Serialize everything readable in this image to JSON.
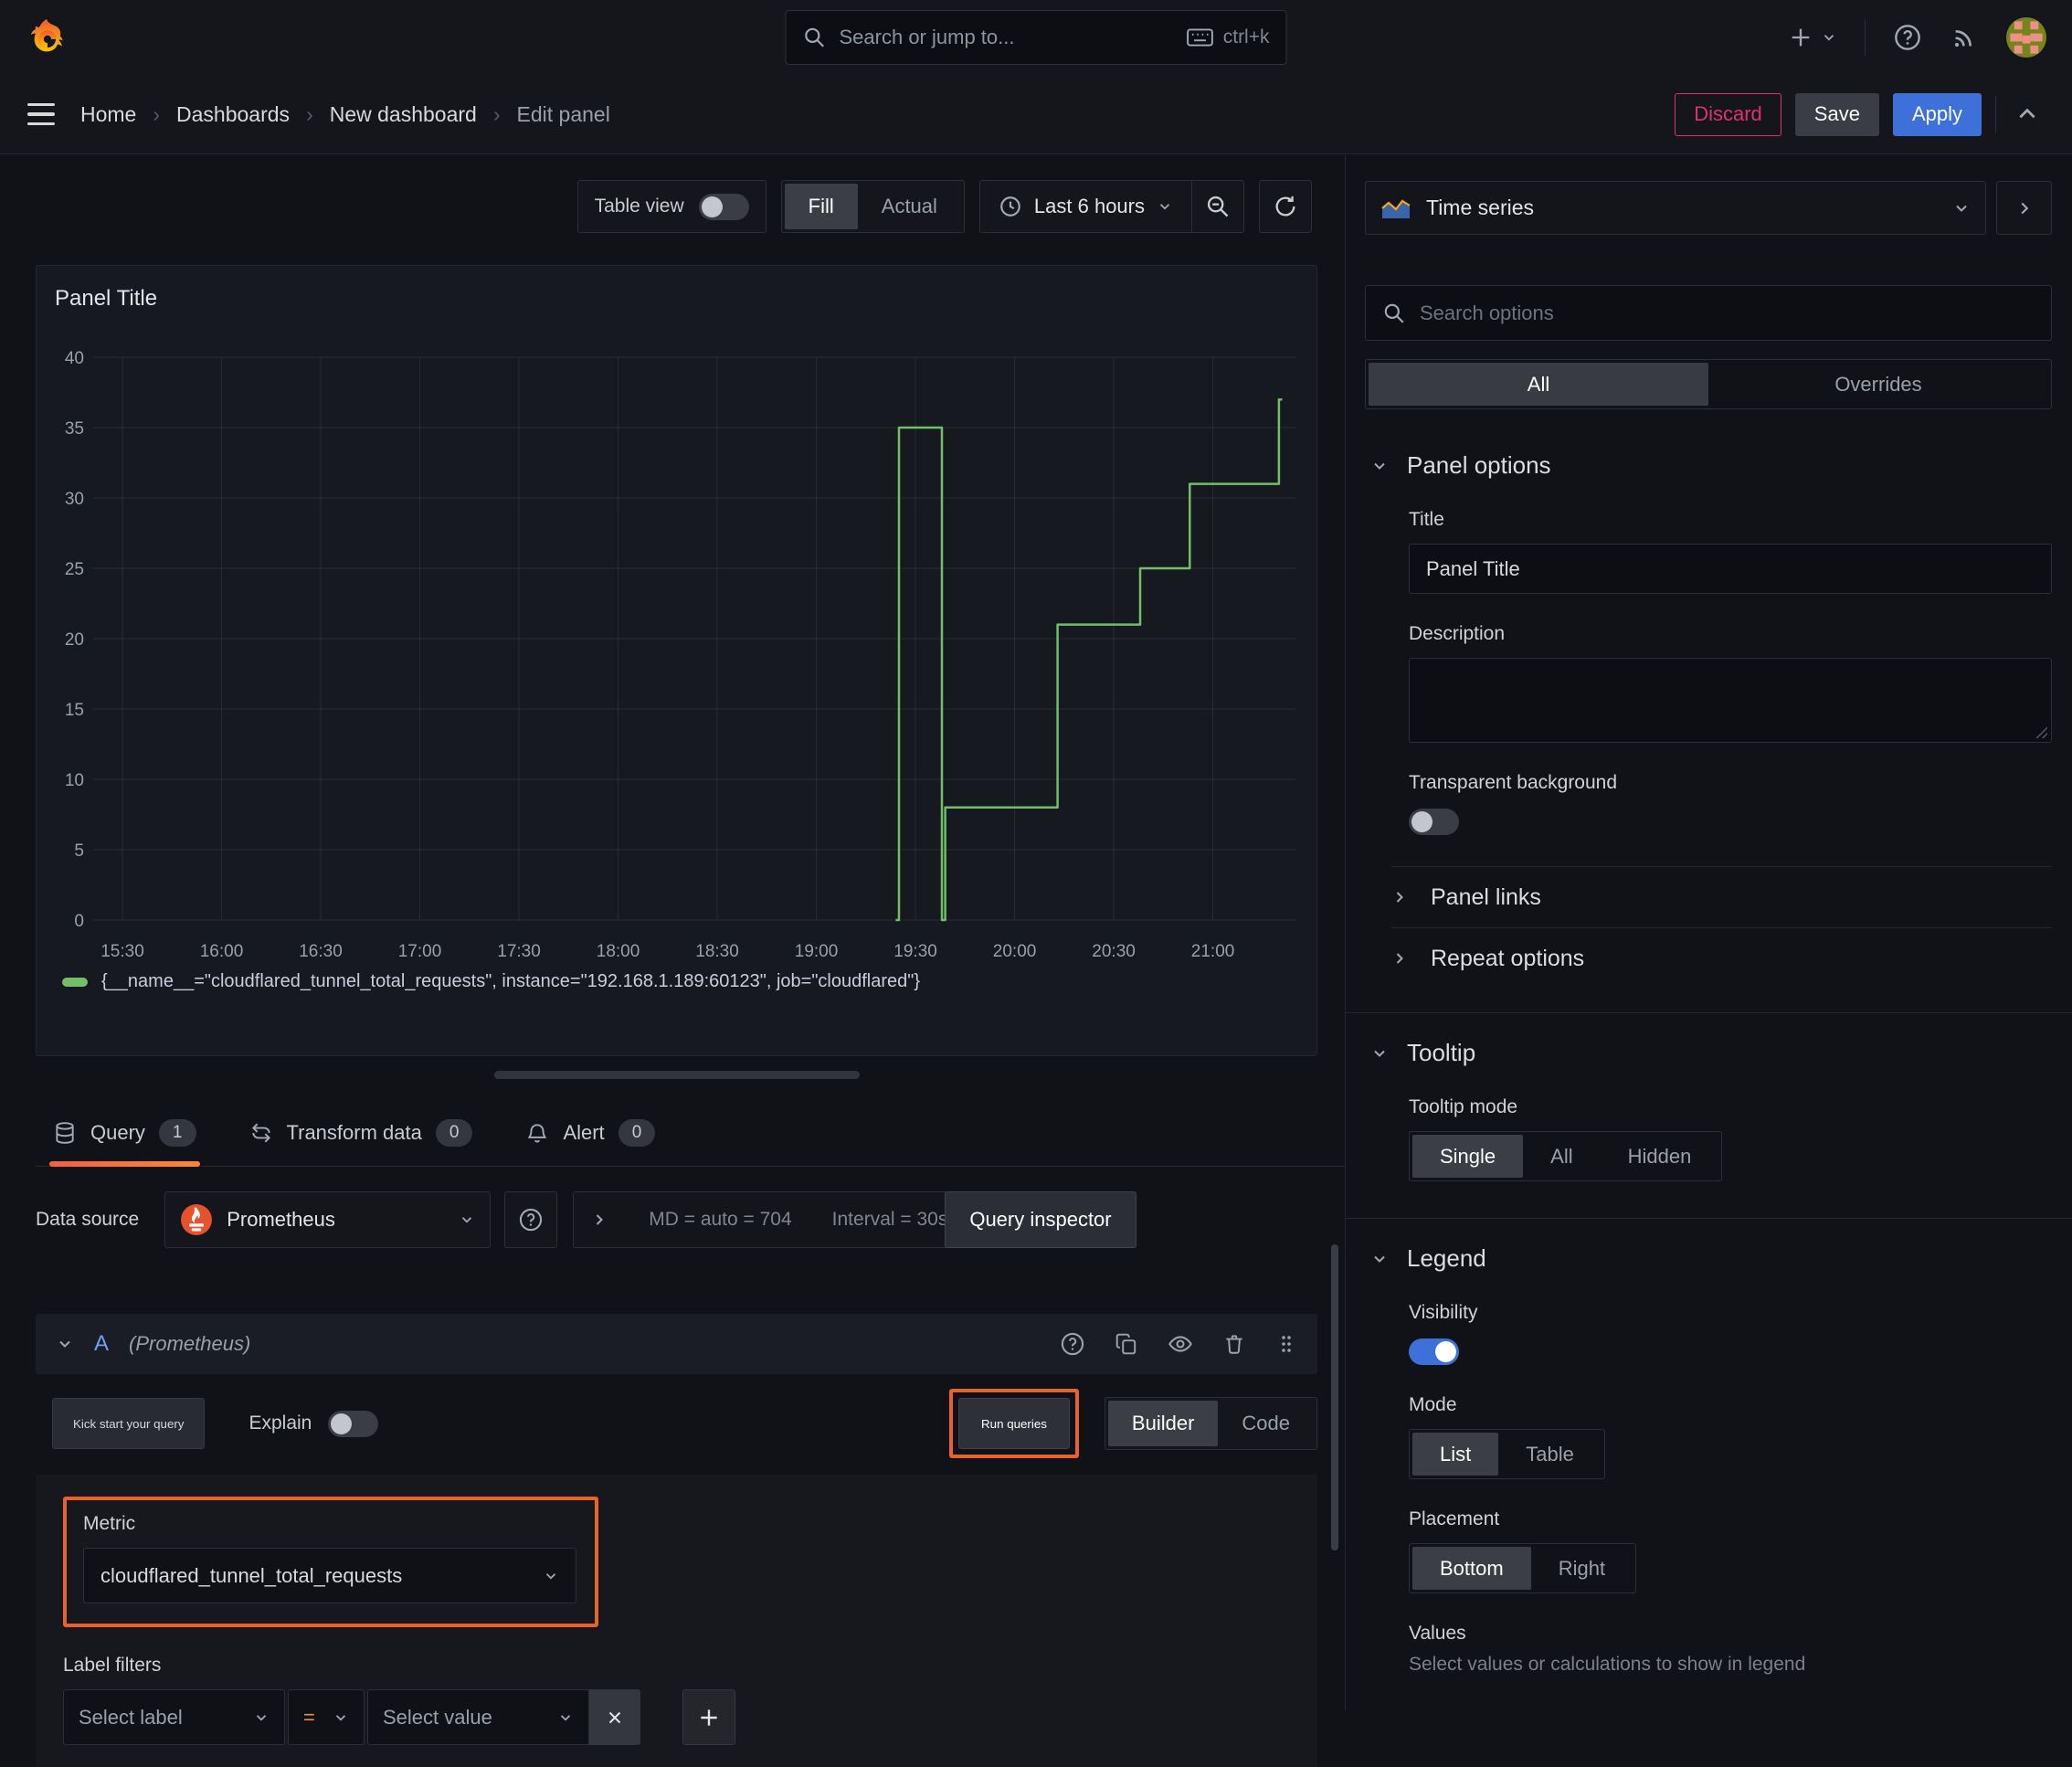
{
  "colors": {
    "annotation_orange": "#e8622d",
    "accent_blue": "#3d71d9",
    "discard_pink": "#e0316e",
    "series_green": "#73bf69"
  },
  "topnav": {
    "search_placeholder": "Search or jump to...",
    "shortcut": "ctrl+k"
  },
  "breadcrumb": {
    "items": [
      "Home",
      "Dashboards",
      "New dashboard",
      "Edit panel"
    ]
  },
  "actions": {
    "discard": "Discard",
    "save": "Save",
    "apply": "Apply"
  },
  "toolbar": {
    "table_view_label": "Table view",
    "fill_label": "Fill",
    "actual_label": "Actual",
    "time_range_label": "Last 6 hours"
  },
  "panel": {
    "title": "Panel Title"
  },
  "chart_data": {
    "type": "line",
    "title": "Panel Title",
    "xlabel": "",
    "ylabel": "",
    "ylim": [
      0,
      40
    ],
    "y_ticks": [
      0,
      5,
      10,
      15,
      20,
      25,
      30,
      35,
      40
    ],
    "x_ticks": [
      "15:30",
      "16:00",
      "16:30",
      "17:00",
      "17:30",
      "18:00",
      "18:30",
      "19:00",
      "19:30",
      "20:00",
      "20:30",
      "21:00"
    ],
    "x_tick_minutes": [
      0,
      30,
      60,
      90,
      120,
      150,
      180,
      210,
      240,
      270,
      300,
      330
    ],
    "x_range_minutes": [
      0,
      355
    ],
    "grid": true,
    "legend_position": "bottom",
    "series": [
      {
        "name": "{__name__=\"cloudflared_tunnel_total_requests\", instance=\"192.168.1.189:60123\", job=\"cloudflared\"}",
        "color": "#73bf69",
        "step_points": [
          [
            234,
            0
          ],
          [
            235,
            0
          ],
          [
            235,
            35
          ],
          [
            248,
            35
          ],
          [
            248,
            0
          ],
          [
            249,
            0
          ],
          [
            249,
            8
          ],
          [
            283,
            8
          ],
          [
            283,
            21
          ],
          [
            308,
            21
          ],
          [
            308,
            25
          ],
          [
            323,
            25
          ],
          [
            323,
            31
          ],
          [
            350,
            31
          ],
          [
            350,
            37
          ],
          [
            351,
            37
          ]
        ]
      }
    ]
  },
  "query_tabs": {
    "query": "Query",
    "query_count": "1",
    "transform": "Transform data",
    "transform_count": "0",
    "alert": "Alert",
    "alert_count": "0"
  },
  "datasource_bar": {
    "label": "Data source",
    "name": "Prometheus",
    "max_data_points": "MD = auto = 704",
    "interval": "Interval = 30s",
    "inspector": "Query inspector"
  },
  "query_editor": {
    "ref_id": "A",
    "datasource_hint": "(Prometheus)",
    "kick_start": "Kick start your query",
    "explain": "Explain",
    "run_queries": "Run queries",
    "builder": "Builder",
    "code": "Code",
    "metric_label": "Metric",
    "metric_value": "cloudflared_tunnel_total_requests",
    "label_filters_label": "Label filters",
    "select_label_placeholder": "Select label",
    "operator": "=",
    "select_value_placeholder": "Select value"
  },
  "options_pane": {
    "visualization": "Time series",
    "search_placeholder": "Search options",
    "tab_all": "All",
    "tab_overrides": "Overrides",
    "panel_options": {
      "header": "Panel options",
      "title_label": "Title",
      "title_value": "Panel Title",
      "description_label": "Description",
      "transparent_label": "Transparent background"
    },
    "panel_links_header": "Panel links",
    "repeat_header": "Repeat options",
    "tooltip": {
      "header": "Tooltip",
      "mode_label": "Tooltip mode",
      "single": "Single",
      "all": "All",
      "hidden": "Hidden"
    },
    "legend": {
      "header": "Legend",
      "visibility_label": "Visibility",
      "mode_label": "Mode",
      "list": "List",
      "table": "Table",
      "placement_label": "Placement",
      "bottom": "Bottom",
      "right": "Right",
      "values_label": "Values",
      "values_help": "Select values or calculations to show in legend"
    }
  }
}
